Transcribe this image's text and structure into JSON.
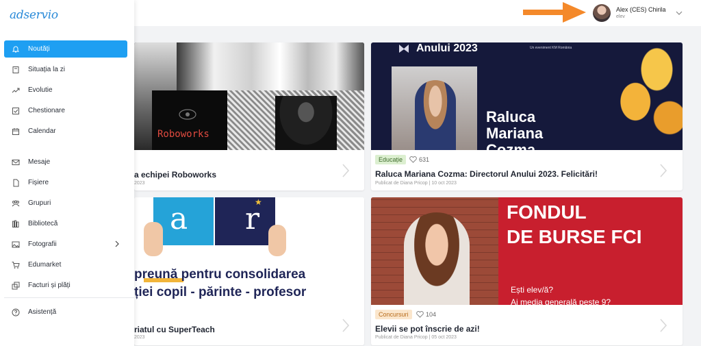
{
  "brand": {
    "logo_text": "adservio",
    "accent": "#1e9ff2"
  },
  "user": {
    "name": "Alex (CES) Chirila",
    "role": "elev"
  },
  "sidebar": {
    "items": [
      {
        "label": "Noutăți",
        "icon": "bell-icon",
        "active": true
      },
      {
        "label": "Situația la zi",
        "icon": "book-icon"
      },
      {
        "label": "Evolutie",
        "icon": "trend-icon"
      },
      {
        "label": "Chestionare",
        "icon": "checkbox-icon"
      },
      {
        "label": "Calendar",
        "icon": "calendar-icon"
      },
      {
        "label": "Mesaje",
        "icon": "mail-icon"
      },
      {
        "label": "Fișiere",
        "icon": "file-icon"
      },
      {
        "label": "Grupuri",
        "icon": "group-icon"
      },
      {
        "label": "Bibliotecă",
        "icon": "library-icon"
      },
      {
        "label": "Fotografii",
        "icon": "image-icon"
      },
      {
        "label": "Edumarket",
        "icon": "cart-icon"
      },
      {
        "label": "Facturi și plăți",
        "icon": "invoice-icon"
      },
      {
        "label": "Asistență",
        "icon": "help-icon"
      }
    ]
  },
  "cards": [
    {
      "title": "a echipei Roboworks",
      "meta": "2023",
      "image_text": "Roboworks"
    },
    {
      "tag": "Educație",
      "likes": "631",
      "title": "Raluca Mariana Cozma: Directorul Anului 2023. Felicitări!",
      "meta": "Publicat de Diana Pricop | 10 oct 2023",
      "image_heading": "Anului 2023",
      "image_small": "Un eveniment KM România",
      "image_name_1": "Raluca",
      "image_name_2": "Mariana",
      "image_name_3": "Cozma"
    },
    {
      "title": "riatul cu SuperTeach",
      "meta": "2023",
      "image_line_1": "preună pentru consolidarea",
      "image_line_2": "ției copil - părinte - profesor"
    },
    {
      "tag": "Concursuri",
      "likes": "104",
      "title": "Elevii se pot înscrie de azi!",
      "meta": "Publicat de Diana Pricop | 05 oct 2023",
      "image_line_1": "FONDUL",
      "image_line_2": "DE BURSE FCI",
      "image_line_3": "Ești elev/ă?",
      "image_line_4": "Ai media generală peste 9?"
    }
  ]
}
